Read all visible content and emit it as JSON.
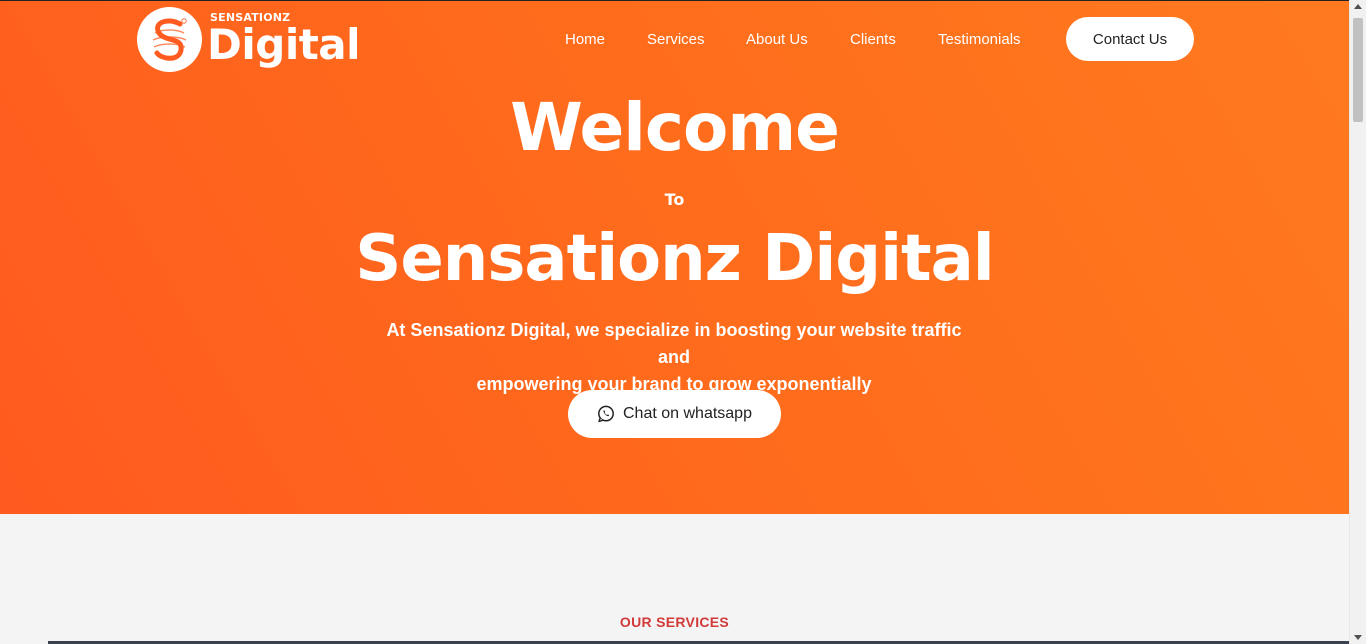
{
  "logo": {
    "top_text": "SENSATIONZ",
    "main_text": "Digital"
  },
  "nav": {
    "items": [
      "Home",
      "Services",
      "About Us",
      "Clients",
      "Testimonials"
    ],
    "contact_label": "Contact Us"
  },
  "hero": {
    "welcome": "Welcome",
    "to": "To",
    "brand": "Sensationz Digital",
    "tagline_line1": "At Sensationz Digital, we specialize in boosting your website traffic and",
    "tagline_line2": "empowering your brand to grow exponentially",
    "whatsapp_label": "Chat on whatsapp"
  },
  "services": {
    "heading": "OUR SERVICES"
  },
  "colors": {
    "hero_gradient_start": "#ff5a1f",
    "hero_gradient_end": "#ff7a1e",
    "services_heading": "#d23a3a",
    "page_bg": "#f4f4f5"
  },
  "icons": {
    "logo": "sensationz-logo-icon",
    "whatsapp": "whatsapp-icon"
  }
}
